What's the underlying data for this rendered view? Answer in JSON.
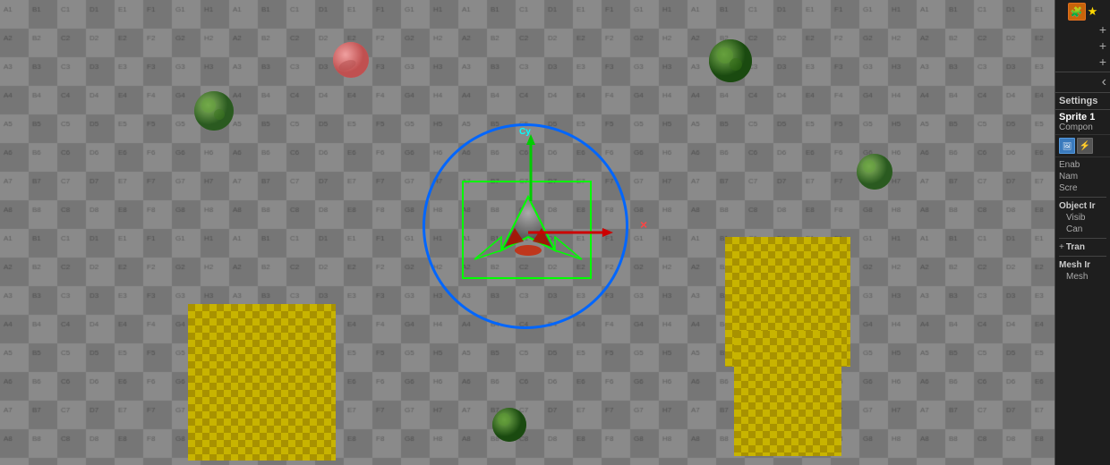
{
  "canvas": {
    "background_color": "#888888",
    "grid_color_light": "#999999",
    "grid_color_dark": "#777777"
  },
  "panel": {
    "settings_label": "Settings",
    "sprite_title": "Sprite 1",
    "component_label": "Compon",
    "enable_label": "Enab",
    "name_label": "Nam",
    "screen_label": "Scre",
    "object_info_label": "Object Ir",
    "visible_label": "Visib",
    "can_label": "Can",
    "transform_label": "Tran",
    "mesh_info_label": "Mesh Ir",
    "mesh_label": "Mesh"
  },
  "icons": {
    "collapse_left": "‹",
    "puzzle": "🧩",
    "star": "★",
    "plus": "+",
    "lightning": "⚡"
  }
}
